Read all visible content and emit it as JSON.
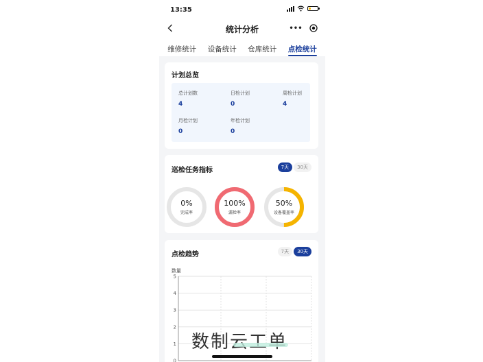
{
  "status": {
    "time": "13:35"
  },
  "nav": {
    "title": "统计分析",
    "more": "•••"
  },
  "tabs": [
    {
      "label": "维修统计",
      "active": false
    },
    {
      "label": "设备统计",
      "active": false
    },
    {
      "label": "仓库统计",
      "active": false
    },
    {
      "label": "点检统计",
      "active": true
    }
  ],
  "plan": {
    "title": "计划总览",
    "items": [
      {
        "label": "总计划数",
        "value": "4"
      },
      {
        "label": "日检计划",
        "value": "0"
      },
      {
        "label": "周检计划",
        "value": "4"
      },
      {
        "label": "月检计划",
        "value": "0"
      },
      {
        "label": "年检计划",
        "value": "0"
      }
    ]
  },
  "task": {
    "title": "巡检任务指标",
    "toggle": [
      "7天",
      "30天"
    ],
    "active": "7天",
    "rings": [
      {
        "pct": "0%",
        "label": "完成率",
        "value": 0,
        "color": "#e6e6e6"
      },
      {
        "pct": "100%",
        "label": "漏检率",
        "value": 1,
        "color": "#f06a72"
      },
      {
        "pct": "50%",
        "label": "设备覆盖率",
        "value": 0.5,
        "color": "#f5b400"
      }
    ]
  },
  "trend": {
    "title": "点检趋势",
    "toggle": [
      "7天",
      "30天"
    ],
    "active": "30天"
  },
  "chart_data": {
    "type": "line",
    "ylabel": "数量",
    "ylim": [
      0,
      5
    ],
    "yticks": [
      "5",
      "4",
      "3",
      "2",
      "1",
      "0"
    ],
    "series": []
  },
  "watermark": "数制云工单"
}
